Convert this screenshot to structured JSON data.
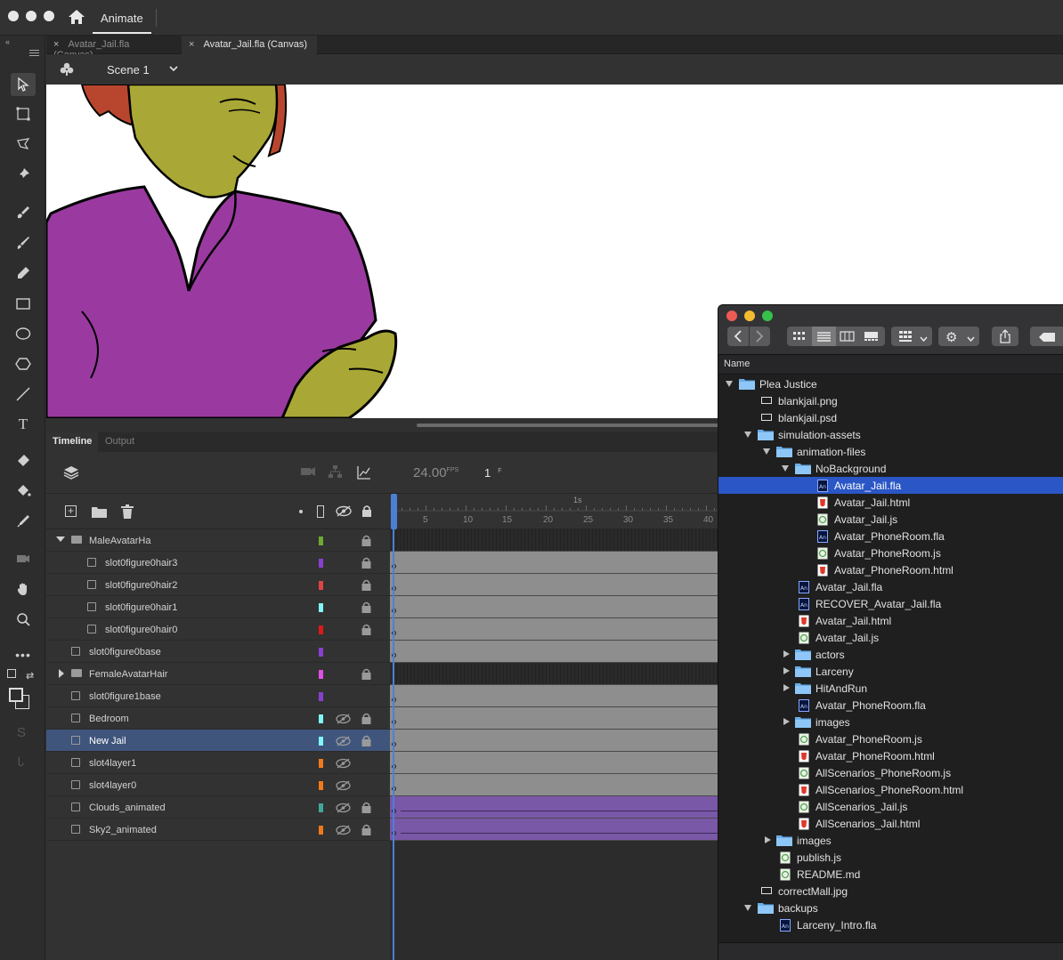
{
  "app": {
    "title": "Animate"
  },
  "document_tabs": [
    {
      "label": "Avatar_Jail.fla (Canvas)",
      "active": false
    },
    {
      "label": "Avatar_Jail.fla (Canvas)",
      "active": true
    }
  ],
  "scene": {
    "label": "Scene 1"
  },
  "tools": [
    "selection-tool-icon",
    "free-transform-tool-icon",
    "lasso-tool-icon",
    "pin-tool-icon",
    "paint-brush-tool-icon",
    "brush-tool-icon",
    "pencil-tool-icon",
    "rectangle-tool-icon",
    "oval-tool-icon",
    "polystar-tool-icon",
    "line-tool-icon",
    "text-tool-icon",
    "eraser-tool-icon",
    "paint-bucket-tool-icon",
    "eyedropper-tool-icon",
    "camera-tool-icon",
    "hand-tool-icon",
    "zoom-tool-icon",
    "more-tools-icon"
  ],
  "timeline": {
    "tabs": [
      {
        "label": "Timeline",
        "active": true
      },
      {
        "label": "Output",
        "active": false
      }
    ],
    "fps": "24.00",
    "fps_unit": "FPS",
    "current_frame": "1",
    "frame_unit": "F",
    "ruler_ticks": [
      "5",
      "10",
      "15",
      "20",
      "25",
      "30",
      "35",
      "40"
    ],
    "ruler_marker": "1s",
    "layers": [
      {
        "name": "MaleAvatarHa",
        "type": "folder",
        "expanded": true,
        "indent": 0,
        "color": "#6fa832",
        "hidden": false,
        "locked": true,
        "selected": false
      },
      {
        "name": "slot0figure0hair3",
        "type": "layer",
        "indent": 1,
        "color": "#8a3fd0",
        "hidden": false,
        "locked": true,
        "selected": false
      },
      {
        "name": "slot0figure0hair2",
        "type": "layer",
        "indent": 1,
        "color": "#e04444",
        "hidden": false,
        "locked": true,
        "selected": false
      },
      {
        "name": "slot0figure0hair1",
        "type": "layer",
        "indent": 1,
        "color": "#7ff7f7",
        "hidden": false,
        "locked": true,
        "selected": false
      },
      {
        "name": "slot0figure0hair0",
        "type": "layer",
        "indent": 1,
        "color": "#e01818",
        "hidden": false,
        "locked": true,
        "selected": false
      },
      {
        "name": "slot0figure0base",
        "type": "layer",
        "indent": 0,
        "color": "#8a3fd0",
        "hidden": false,
        "locked": false,
        "selected": false
      },
      {
        "name": "FemaleAvatarHair",
        "type": "folder",
        "expanded": false,
        "indent": 0,
        "color": "#e04fe6",
        "hidden": false,
        "locked": true,
        "selected": false
      },
      {
        "name": "slot0figure1base",
        "type": "layer",
        "indent": 0,
        "color": "#8a3fd0",
        "hidden": false,
        "locked": false,
        "selected": false
      },
      {
        "name": "Bedroom",
        "type": "layer",
        "indent": 0,
        "color": "#7ff7f7",
        "hidden": true,
        "locked": true,
        "selected": false
      },
      {
        "name": "New Jail",
        "type": "layer",
        "indent": 0,
        "color": "#7ff7f7",
        "hidden": true,
        "locked": true,
        "selected": true
      },
      {
        "name": "slot4layer1",
        "type": "layer",
        "indent": 0,
        "color": "#f07a1a",
        "hidden": true,
        "locked": false,
        "selected": false
      },
      {
        "name": "slot4layer0",
        "type": "layer",
        "indent": 0,
        "color": "#f07a1a",
        "hidden": true,
        "locked": false,
        "selected": false
      },
      {
        "name": "Clouds_animated",
        "type": "layer",
        "indent": 0,
        "color": "#3fa89a",
        "hidden": true,
        "locked": true,
        "selected": false
      },
      {
        "name": "Sky2_animated",
        "type": "layer",
        "indent": 0,
        "color": "#f07a1a",
        "hidden": true,
        "locked": true,
        "selected": false
      }
    ]
  },
  "finder": {
    "column_header": "Name",
    "items": [
      {
        "label": "Plea Justice",
        "kind": "folder",
        "depth": 0,
        "expanded": true
      },
      {
        "label": "blankjail.png",
        "kind": "image",
        "depth": 1
      },
      {
        "label": "blankjail.psd",
        "kind": "image",
        "depth": 1
      },
      {
        "label": "simulation-assets",
        "kind": "folder",
        "depth": 1,
        "expanded": true
      },
      {
        "label": "animation-files",
        "kind": "folder",
        "depth": 2,
        "expanded": true
      },
      {
        "label": "NoBackground",
        "kind": "folder",
        "depth": 3,
        "expanded": true
      },
      {
        "label": "Avatar_Jail.fla",
        "kind": "fla",
        "depth": 4,
        "selected": true
      },
      {
        "label": "Avatar_Jail.html",
        "kind": "html",
        "depth": 4
      },
      {
        "label": "Avatar_Jail.js",
        "kind": "js",
        "depth": 4
      },
      {
        "label": "Avatar_PhoneRoom.fla",
        "kind": "fla",
        "depth": 4
      },
      {
        "label": "Avatar_PhoneRoom.js",
        "kind": "js",
        "depth": 4
      },
      {
        "label": "Avatar_PhoneRoom.html",
        "kind": "html",
        "depth": 4
      },
      {
        "label": "Avatar_Jail.fla",
        "kind": "fla",
        "depth": 3
      },
      {
        "label": "RECOVER_Avatar_Jail.fla",
        "kind": "fla",
        "depth": 3
      },
      {
        "label": "Avatar_Jail.html",
        "kind": "html",
        "depth": 3
      },
      {
        "label": "Avatar_Jail.js",
        "kind": "js",
        "depth": 3
      },
      {
        "label": "actors",
        "kind": "folder",
        "depth": 3,
        "expanded": false
      },
      {
        "label": "Larceny",
        "kind": "folder",
        "depth": 3,
        "expanded": false
      },
      {
        "label": "HitAndRun",
        "kind": "folder",
        "depth": 3,
        "expanded": false
      },
      {
        "label": "Avatar_PhoneRoom.fla",
        "kind": "fla",
        "depth": 3
      },
      {
        "label": "images",
        "kind": "folder",
        "depth": 3,
        "expanded": false
      },
      {
        "label": "Avatar_PhoneRoom.js",
        "kind": "js",
        "depth": 3
      },
      {
        "label": "Avatar_PhoneRoom.html",
        "kind": "html",
        "depth": 3
      },
      {
        "label": "AllScenarios_PhoneRoom.js",
        "kind": "js",
        "depth": 3
      },
      {
        "label": "AllScenarios_PhoneRoom.html",
        "kind": "html",
        "depth": 3
      },
      {
        "label": "AllScenarios_Jail.js",
        "kind": "js",
        "depth": 3
      },
      {
        "label": "AllScenarios_Jail.html",
        "kind": "html",
        "depth": 3
      },
      {
        "label": "images",
        "kind": "folder",
        "depth": 2,
        "expanded": false
      },
      {
        "label": "publish.js",
        "kind": "js",
        "depth": 2
      },
      {
        "label": "README.md",
        "kind": "js",
        "depth": 2
      },
      {
        "label": "correctMall.jpg",
        "kind": "image",
        "depth": 1
      },
      {
        "label": "backups",
        "kind": "folder",
        "depth": 1,
        "expanded": true
      },
      {
        "label": "Larceny_Intro.fla",
        "kind": "fla",
        "depth": 2
      }
    ]
  },
  "colors": {
    "accent": "#2a56c6",
    "layer_selected": "#3f557c",
    "shirt": "#9a3aa0",
    "skin": "#a9a836",
    "hair": "#b8462e"
  }
}
